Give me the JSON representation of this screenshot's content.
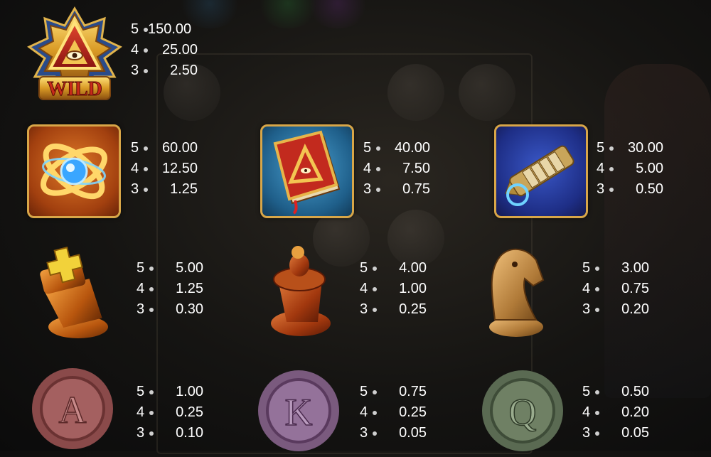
{
  "paytable": {
    "wild": {
      "icon": "wild-eye-pyramid-icon",
      "label": "WILD",
      "pays": [
        {
          "n": "5",
          "v": "150.00"
        },
        {
          "n": "4",
          "v": "25.00"
        },
        {
          "n": "3",
          "v": "2.50"
        }
      ]
    },
    "high": [
      {
        "icon": "golden-armillary-sphere-icon",
        "pays": [
          {
            "n": "5",
            "v": "60.00"
          },
          {
            "n": "4",
            "v": "12.50"
          },
          {
            "n": "3",
            "v": "1.25"
          }
        ]
      },
      {
        "icon": "red-book-icon",
        "pays": [
          {
            "n": "5",
            "v": "40.00"
          },
          {
            "n": "4",
            "v": "7.50"
          },
          {
            "n": "3",
            "v": "0.75"
          }
        ]
      },
      {
        "icon": "cryptex-icon",
        "pays": [
          {
            "n": "5",
            "v": "30.00"
          },
          {
            "n": "4",
            "v": "5.00"
          },
          {
            "n": "3",
            "v": "0.50"
          }
        ]
      }
    ],
    "mid": [
      {
        "icon": "chess-king-icon",
        "pays": [
          {
            "n": "5",
            "v": "5.00"
          },
          {
            "n": "4",
            "v": "1.25"
          },
          {
            "n": "3",
            "v": "0.30"
          }
        ]
      },
      {
        "icon": "chess-pawn-icon",
        "pays": [
          {
            "n": "5",
            "v": "4.00"
          },
          {
            "n": "4",
            "v": "1.00"
          },
          {
            "n": "3",
            "v": "0.25"
          }
        ]
      },
      {
        "icon": "chess-knight-icon",
        "pays": [
          {
            "n": "5",
            "v": "3.00"
          },
          {
            "n": "4",
            "v": "0.75"
          },
          {
            "n": "3",
            "v": "0.20"
          }
        ]
      }
    ],
    "low": [
      {
        "icon": "wax-seal-a-icon",
        "letter": "A",
        "pays": [
          {
            "n": "5",
            "v": "1.00"
          },
          {
            "n": "4",
            "v": "0.25"
          },
          {
            "n": "3",
            "v": "0.10"
          }
        ]
      },
      {
        "icon": "wax-seal-k-icon",
        "letter": "K",
        "pays": [
          {
            "n": "5",
            "v": "0.75"
          },
          {
            "n": "4",
            "v": "0.25"
          },
          {
            "n": "3",
            "v": "0.05"
          }
        ]
      },
      {
        "icon": "wax-seal-q-icon",
        "letter": "Q",
        "pays": [
          {
            "n": "5",
            "v": "0.50"
          },
          {
            "n": "4",
            "v": "0.20"
          },
          {
            "n": "3",
            "v": "0.05"
          }
        ]
      }
    ]
  },
  "colors": {
    "gold": "#d8a648",
    "text": "#ffffff",
    "background": "#151412"
  }
}
